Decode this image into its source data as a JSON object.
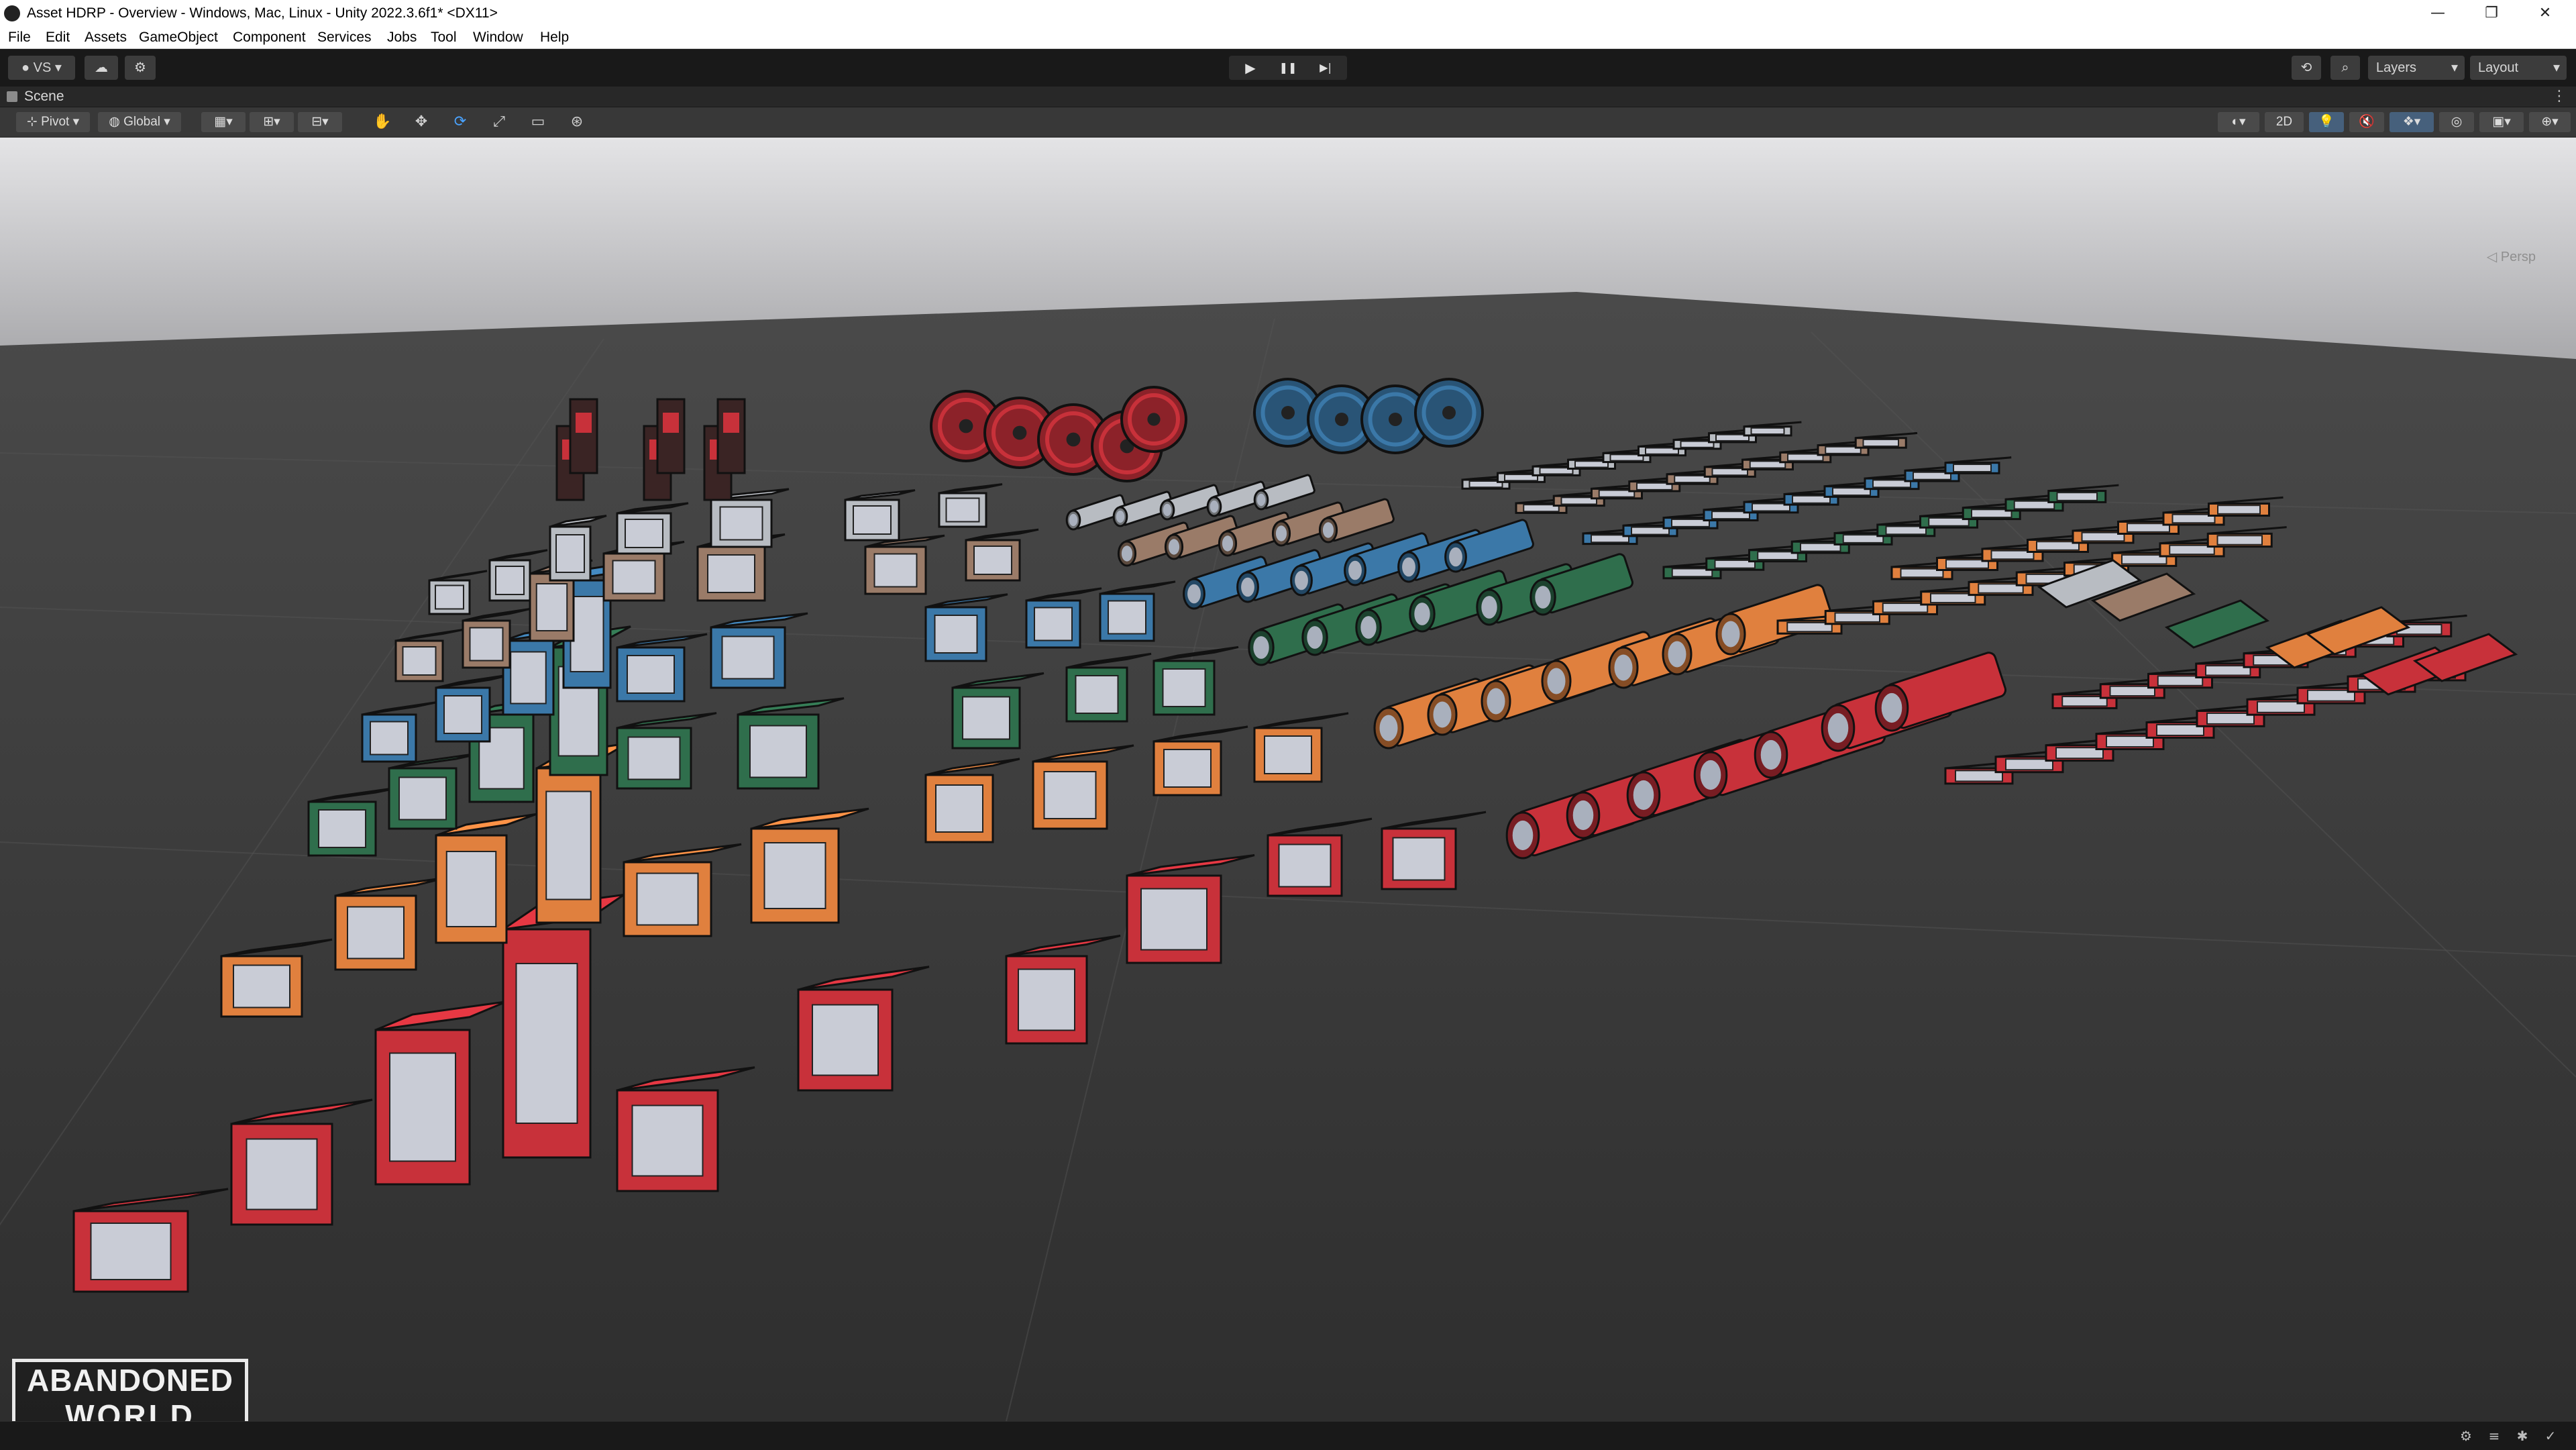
{
  "window": {
    "title": "Asset HDRP - Overview - Windows, Mac, Linux - Unity 2022.3.6f1* <DX11>",
    "controls": [
      "minimize-icon",
      "restore-icon",
      "close-icon"
    ],
    "control_glyphs": [
      "—",
      "❐",
      "✕"
    ]
  },
  "menu": [
    "File",
    "Edit",
    "Assets",
    "GameObject",
    "Component",
    "Services",
    "Jobs",
    "Tool",
    "Window",
    "Help"
  ],
  "toolbar": {
    "account_label": "VS",
    "play_glyphs": [
      "▶",
      "❚❚",
      "▶|"
    ],
    "layers_label": "Layers",
    "layout_label": "Layout"
  },
  "scene_tab": {
    "label": "Scene",
    "more_glyph": "⋮"
  },
  "scene_toolbar": {
    "pivot_label": "Pivot",
    "global_label": "Global",
    "mode_2d_label": "2D",
    "tool_glyphs": [
      "✋",
      "✥",
      "⟳",
      "⤢",
      "▭",
      "⊛"
    ]
  },
  "viewport": {
    "camera_label": "◁ Persp",
    "floor_color": "#3a3a3a",
    "sky_color": "#c9c9cb",
    "colors": {
      "red": "#c8313a",
      "orange": "#e0803e",
      "green": "#2f6e4c",
      "blue": "#3b78a8",
      "tan": "#9a7b68",
      "grey": "#b8bcc2"
    }
  },
  "logo": {
    "line1": "ABANDONED",
    "line2": "WORLD"
  },
  "statusbar": {
    "icons": [
      "debug-icon",
      "cache-icon",
      "bug-icon",
      "check-icon"
    ]
  }
}
